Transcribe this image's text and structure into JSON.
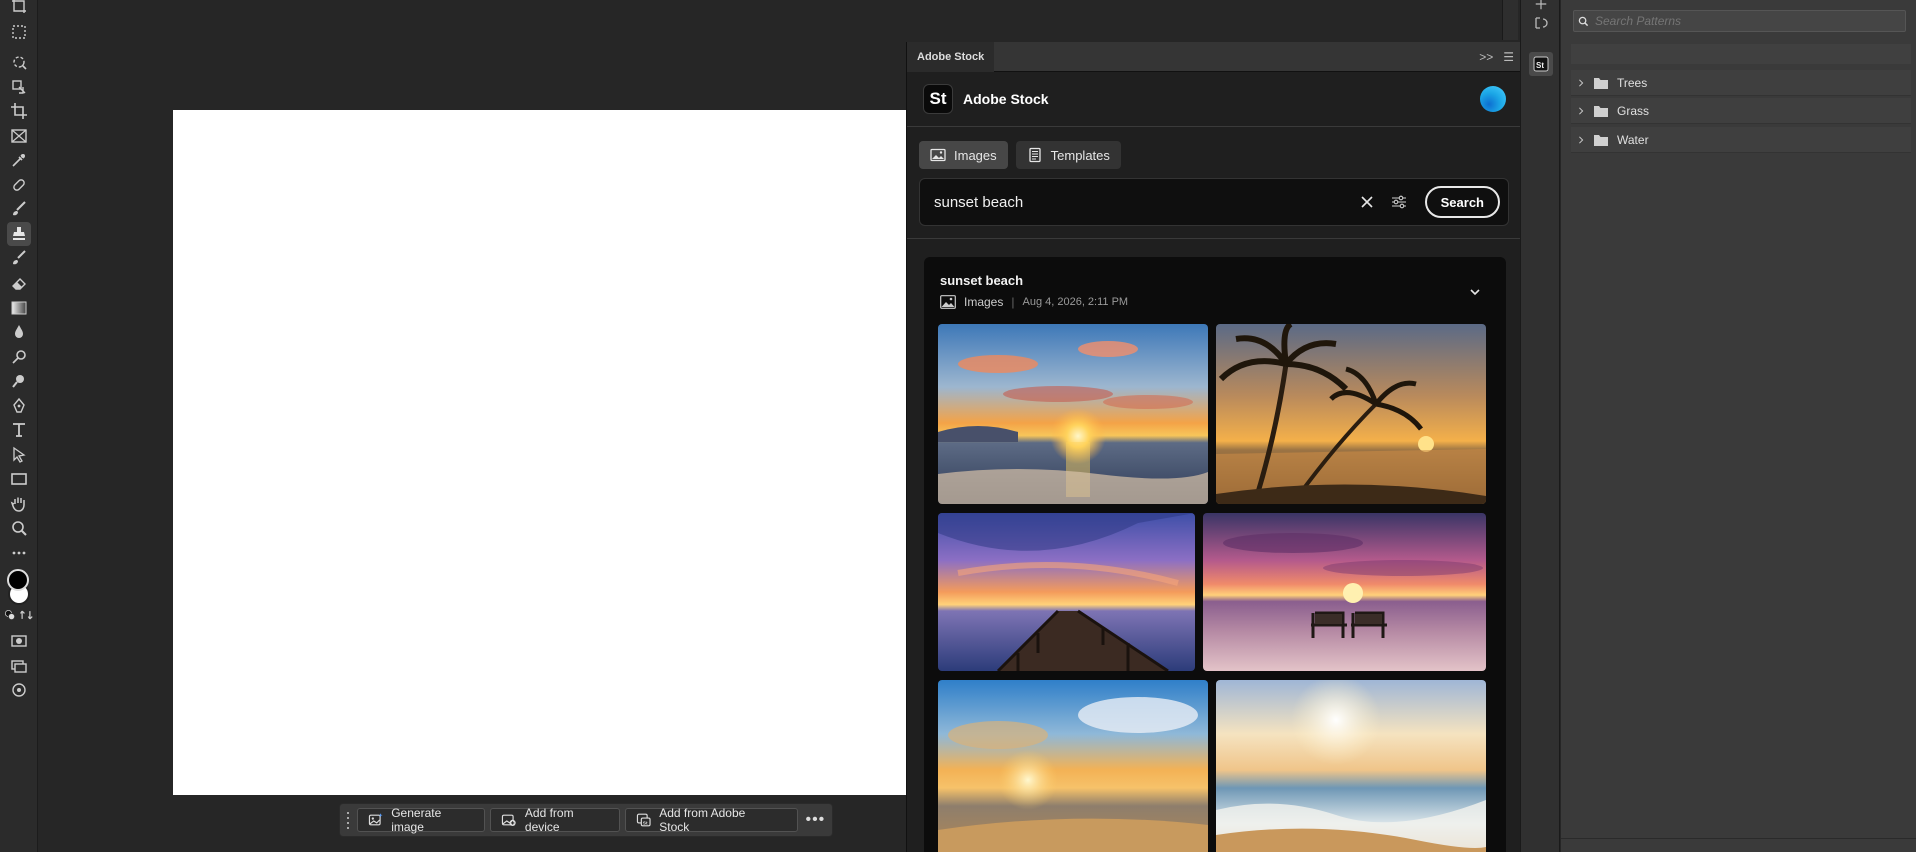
{
  "stock_panel": {
    "tab_title": "Adobe Stock",
    "brand_logo": "St",
    "brand_name": "Adobe Stock",
    "tabs": [
      {
        "label": "Images",
        "icon": "image-icon",
        "selected": true
      },
      {
        "label": "Templates",
        "icon": "template-icon",
        "selected": false
      }
    ],
    "search": {
      "value": "sunset beach",
      "button_label": "Search"
    },
    "results": {
      "title": "sunset beach",
      "type_label": "Images",
      "date": "Aug 4, 2026, 2:11 PM"
    }
  },
  "taskbar": {
    "generate_label": "Generate image",
    "device_label": "Add from device",
    "stock_label": "Add from Adobe Stock",
    "more_label": "•••"
  },
  "patterns_panel": {
    "search_placeholder": "Search Patterns",
    "folders": [
      {
        "label": "Trees"
      },
      {
        "label": "Grass"
      },
      {
        "label": "Water"
      }
    ]
  },
  "colors": {
    "foreground": "#000000",
    "background": "#ffffff",
    "accent": "#1ba6e6"
  }
}
